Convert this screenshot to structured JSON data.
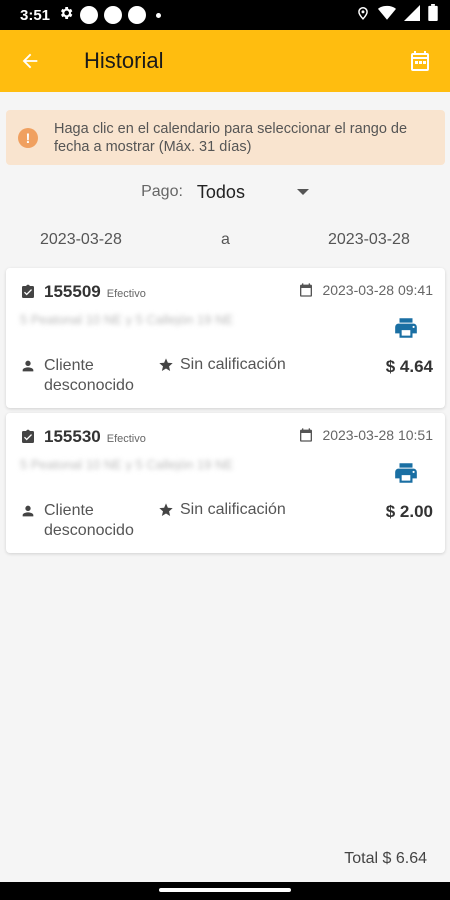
{
  "status_bar": {
    "time": "3:51"
  },
  "app_bar": {
    "title": "Historial"
  },
  "info": {
    "icon": "!",
    "text": "Haga clic en el calendario para seleccionar el rango de fecha a mostrar (Máx. 31 días)"
  },
  "filter": {
    "label": "Pago:",
    "value": "Todos"
  },
  "date_range": {
    "from": "2023-03-28",
    "separator": "a",
    "to": "2023-03-28"
  },
  "orders": [
    {
      "id": "155509",
      "method": "Efectivo",
      "datetime": "2023-03-28 09:41",
      "address": "5 Peatonal 10 NE y 5 Callejón 19 NE",
      "client": "Cliente desconocido",
      "rating": "Sin calificación",
      "amount": "$ 4.64"
    },
    {
      "id": "155530",
      "method": "Efectivo",
      "datetime": "2023-03-28 10:51",
      "address": "5 Peatonal 10 NE y 5 Callejón 19 NE",
      "client": "Cliente desconocido",
      "rating": "Sin calificación",
      "amount": "$ 2.00"
    }
  ],
  "total": "Total $ 6.64",
  "colors": {
    "accent": "#ffbd0f",
    "banner": "#f9e4cf",
    "print_icon": "#1a6fa3"
  }
}
